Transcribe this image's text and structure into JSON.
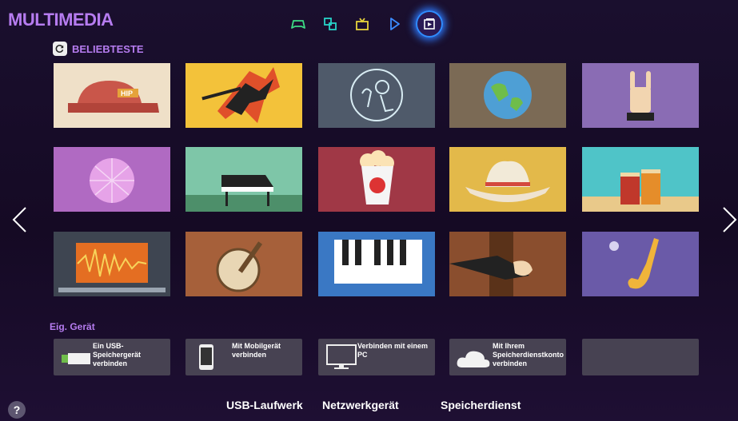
{
  "header": {
    "title": "MULTIMEDIA"
  },
  "nav": {
    "icons": [
      "gamepad-icon",
      "apps-icon",
      "tv-icon",
      "play-icon",
      "multimedia-icon"
    ],
    "active_index": 4
  },
  "section": {
    "label": "BELIEBTESTE"
  },
  "tiles": [
    {
      "icon": "hip-hop-cap-icon"
    },
    {
      "icon": "electric-guitar-icon"
    },
    {
      "icon": "singer-icon"
    },
    {
      "icon": "globe-icon"
    },
    {
      "icon": "rock-hand-icon"
    },
    {
      "icon": "disco-ball-icon"
    },
    {
      "icon": "piano-icon"
    },
    {
      "icon": "popcorn-icon"
    },
    {
      "icon": "cowboy-hat-icon"
    },
    {
      "icon": "bongo-drums-icon"
    },
    {
      "icon": "waveform-icon"
    },
    {
      "icon": "banjo-icon"
    },
    {
      "icon": "keyboard-icon"
    },
    {
      "icon": "double-bass-icon"
    },
    {
      "icon": "saxophone-icon"
    }
  ],
  "own_device": {
    "label": "Eig. Gerät",
    "items": [
      {
        "icon": "usb-icon",
        "label": "Ein USB-Speichergerät verbinden"
      },
      {
        "icon": "mobile-icon",
        "label": "Mit Mobilgerät verbinden"
      },
      {
        "icon": "pc-icon",
        "label": "Verbinden mit einem PC"
      },
      {
        "icon": "cloud-icon",
        "label": "Mit Ihrem Speicherdienstkonto verbinden"
      }
    ]
  },
  "bottom_tabs": [
    "USB-Laufwerk",
    "Netzwerkgerät",
    "Speicherdienst"
  ],
  "help": {
    "label": "?"
  },
  "colors": {
    "accent": "#b67cf0",
    "active_glow": "#2e7bff"
  }
}
